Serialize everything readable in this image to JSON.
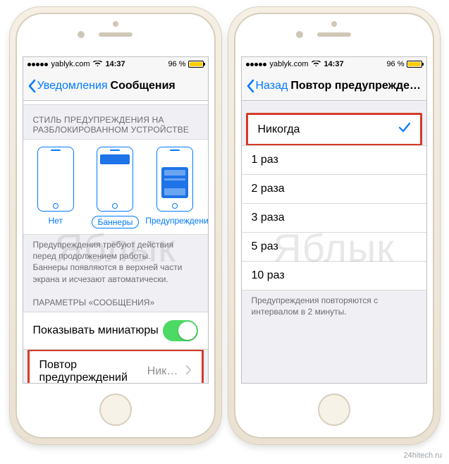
{
  "status": {
    "carrier": "yablyk.com",
    "time": "14:37",
    "battery_pct": "96 %"
  },
  "left": {
    "nav": {
      "back": "Уведомления",
      "title": "Сообщения"
    },
    "section_style_header": "СТИЛЬ ПРЕДУПРЕЖДЕНИЯ НА РАЗБЛОКИРОВАННОМ УСТРОЙСТВЕ",
    "style_options": {
      "none": "Нет",
      "banners": "Баннеры",
      "alerts": "Предупреждения"
    },
    "style_footer": "Предупреждения требуют действия перед продолжением работы.\nБаннеры появляются в верхней части экрана и исчезают автоматически.",
    "params_header": "ПАРАМЕТРЫ «СООБЩЕНИЯ»",
    "thumbnails_label": "Показывать миниатюры",
    "repeat_label": "Повтор предупреждений",
    "repeat_value": "Никог…"
  },
  "right": {
    "nav": {
      "back": "Назад",
      "title": "Повтор предупреждений"
    },
    "options": [
      {
        "label": "Никогда",
        "selected": true
      },
      {
        "label": "1 раз",
        "selected": false
      },
      {
        "label": "2 раза",
        "selected": false
      },
      {
        "label": "3 раза",
        "selected": false
      },
      {
        "label": "5 раз",
        "selected": false
      },
      {
        "label": "10 раз",
        "selected": false
      }
    ],
    "footer": "Предупреждения повторяются с интервалом в 2 минуты."
  },
  "watermark": "Яблык",
  "credit": "24hitech.ru"
}
